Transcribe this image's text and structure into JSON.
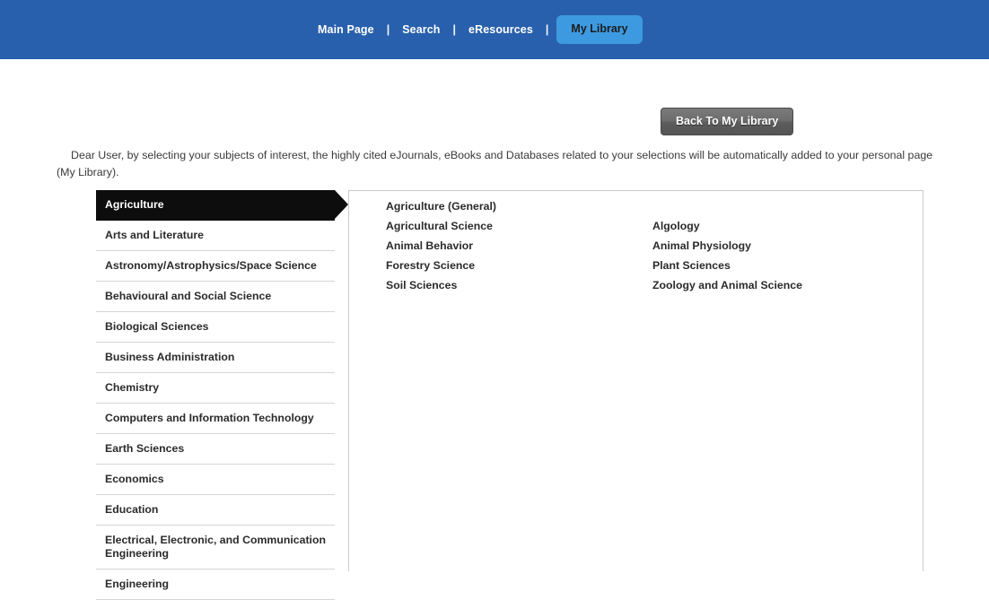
{
  "header": {
    "nav_items": [
      {
        "label": "Main Page",
        "active": false
      },
      {
        "label": "Search",
        "active": false
      },
      {
        "label": "eResources",
        "active": false
      }
    ],
    "separator": "|",
    "active_tab": "My Library",
    "bar_color": "#2860ad",
    "tab_color": "#3d9ae0"
  },
  "toolbar": {
    "back_button_label": "Back To My Library"
  },
  "intro": {
    "text": "Dear User, by selecting your subjects of interest, the highly cited eJournals, eBooks and Databases related to your selections will be automatically added to your personal page (My Library)."
  },
  "sidebar": {
    "selected_index": 0,
    "items": [
      {
        "label": "Agriculture"
      },
      {
        "label": "Arts and Literature"
      },
      {
        "label": "Astronomy/Astrophysics/Space Science"
      },
      {
        "label": "Behavioural and Social Science"
      },
      {
        "label": "Biological Sciences"
      },
      {
        "label": "Business Administration"
      },
      {
        "label": "Chemistry"
      },
      {
        "label": "Computers and Information Technology"
      },
      {
        "label": "Earth Sciences"
      },
      {
        "label": "Economics"
      },
      {
        "label": "Education"
      },
      {
        "label": "Electrical, Electronic, and Communication Engineering"
      },
      {
        "label": "Engineering"
      }
    ]
  },
  "panel": {
    "column_left": [
      {
        "label": "Agriculture (General)"
      },
      {
        "label": "Agricultural Science"
      },
      {
        "label": "Animal Behavior"
      },
      {
        "label": "Forestry Science"
      },
      {
        "label": "Soil Sciences"
      }
    ],
    "column_right": [
      {
        "label": "Algology"
      },
      {
        "label": "Animal Physiology"
      },
      {
        "label": "Plant Sciences"
      },
      {
        "label": "Zoology and Animal Science"
      }
    ]
  }
}
